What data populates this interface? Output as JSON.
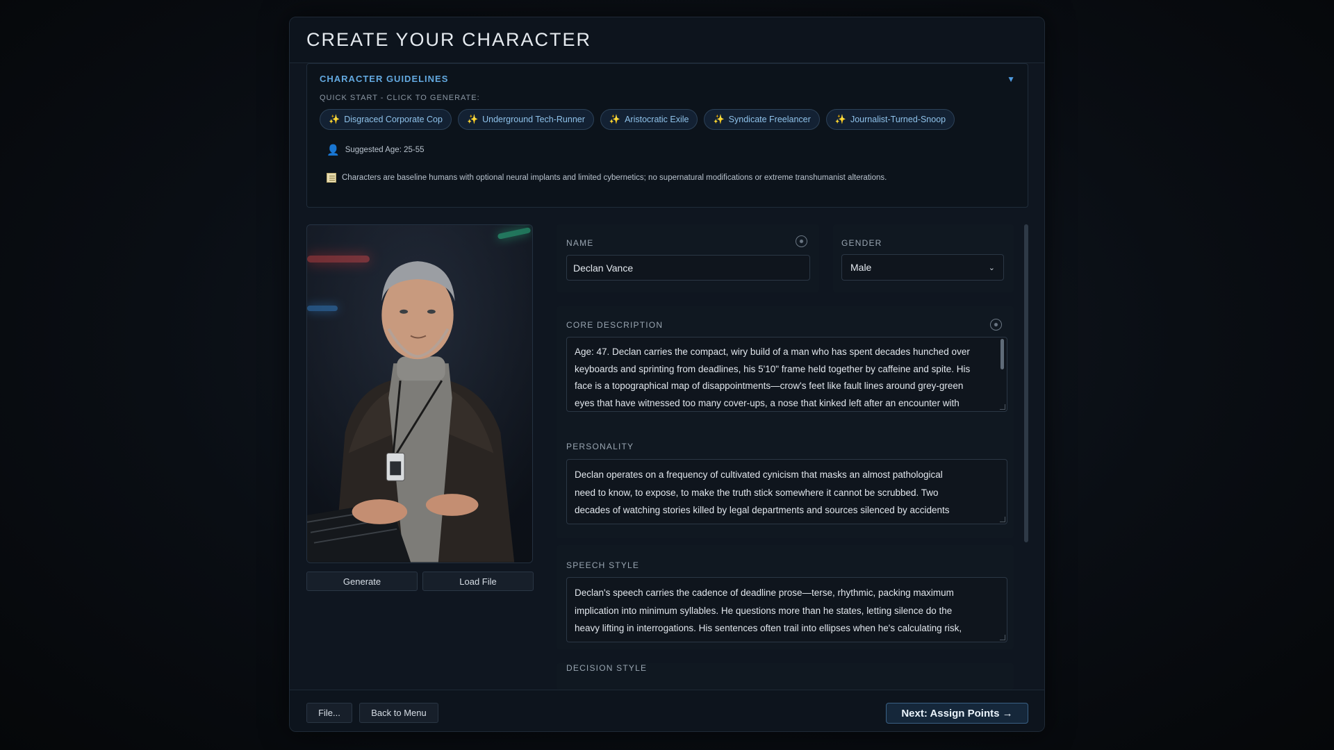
{
  "page_title": "CREATE YOUR CHARACTER",
  "guidelines": {
    "title": "CHARACTER GUIDELINES",
    "collapse_glyph": "▼",
    "quick_start_label": "QUICK START - CLICK TO GENERATE:",
    "chips": [
      "Disgraced Corporate Cop",
      "Underground Tech-Runner",
      "Aristocratic Exile",
      "Syndicate Freelancer",
      "Journalist-Turned-Snoop"
    ],
    "chip_icon": "sparkles-icon",
    "suggested_age": "Suggested Age: 25-55",
    "note": "Characters are baseline humans with optional neural implants and limited cybernetics; no supernatural modifications or extreme transhumanist alterations."
  },
  "portrait": {
    "generate_label": "Generate",
    "load_label": "Load File"
  },
  "form": {
    "name_label": "NAME",
    "name_value": "Declan Vance",
    "gender_label": "GENDER",
    "gender_value": "Male",
    "core_label": "CORE DESCRIPTION",
    "core_lines": [
      "Age: 47. Declan carries the compact, wiry build of a man who has spent decades hunched over",
      "keyboards and sprinting from deadlines, his 5'10\" frame held together by caffeine and spite. His",
      "face is a topographical map of disappointments—crow's feet like fault lines around grey-green",
      "eyes that have witnessed too many cover-ups, a nose that kinked left after an encounter with"
    ],
    "personality_label": "PERSONALITY",
    "personality_lines": [
      "Declan operates on a frequency of cultivated cynicism that masks an almost pathological",
      "need to know, to expose, to make the truth stick somewhere it cannot be scrubbed. Two",
      "decades of watching stories killed by legal departments and sources silenced by accidents"
    ],
    "speech_label": "SPEECH STYLE",
    "speech_lines": [
      "Declan's speech carries the cadence of deadline prose—terse, rhythmic, packing maximum",
      "implication into minimum syllables. He questions more than he states, letting silence do the",
      "heavy lifting in interrogations. His sentences often trail into ellipses when he's calculating risk,"
    ],
    "decision_label": "DECISION STYLE"
  },
  "footer": {
    "file_label": "File...",
    "back_label": "Back to Menu",
    "next_label": "Next: Assign Points →"
  }
}
